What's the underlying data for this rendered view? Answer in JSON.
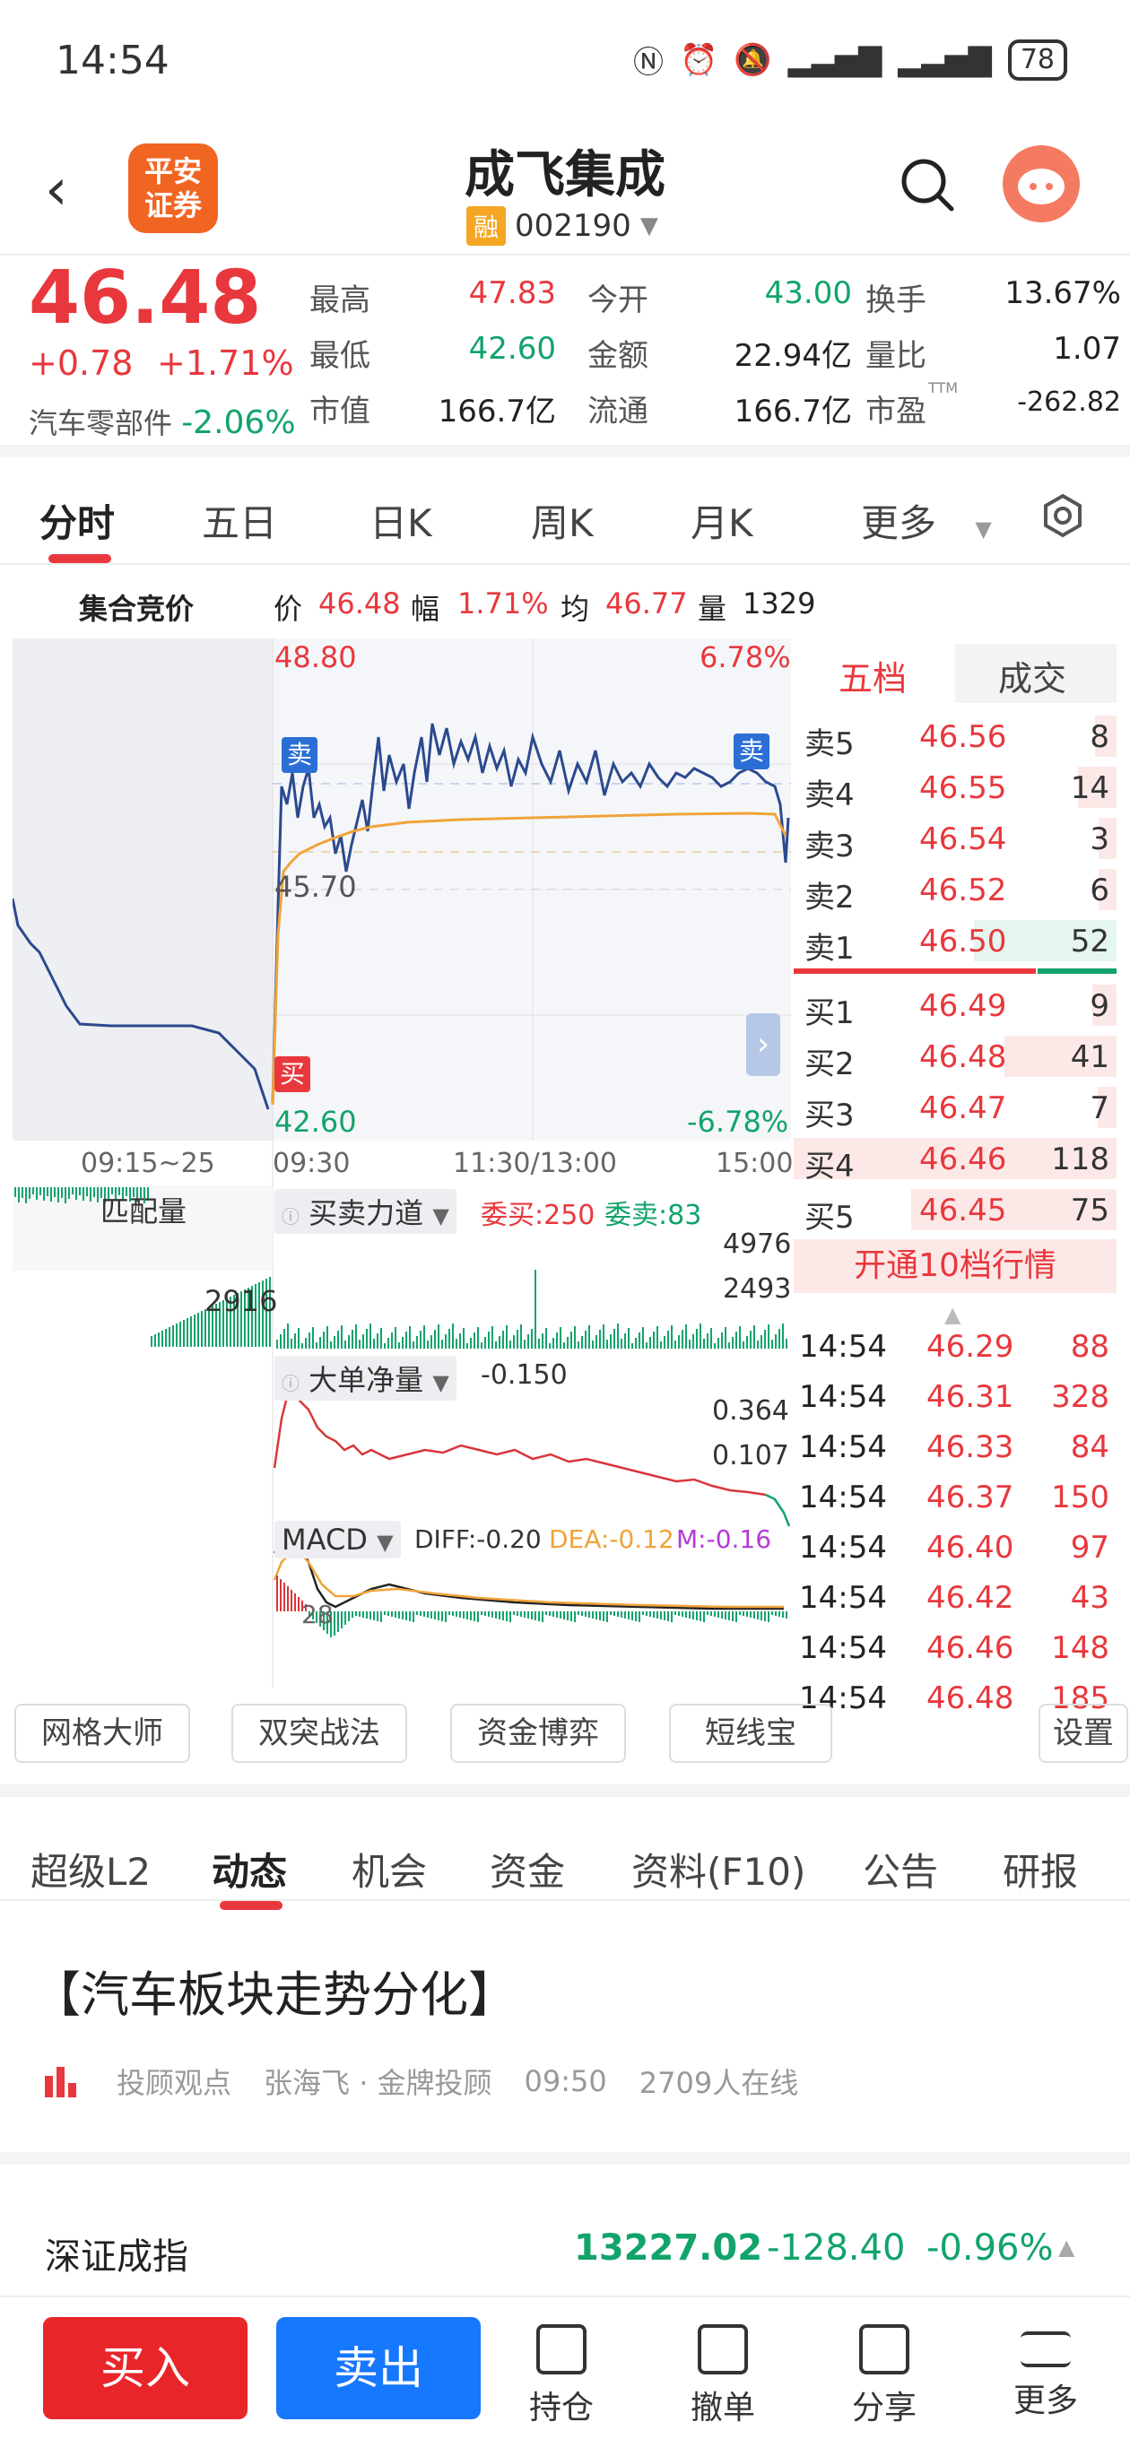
{
  "status": {
    "time": "14:54",
    "battery": "78"
  },
  "header": {
    "title": "成飞集成",
    "code": "002190",
    "margin_tag": "融",
    "broker_logo_line1": "平安",
    "broker_logo_line2": "证券"
  },
  "quote": {
    "price": "46.48",
    "change": "+0.78",
    "change_pct": "+1.71%",
    "sector_name": "汽车零部件",
    "sector_change": "-2.06%",
    "fields": [
      {
        "label": "最高",
        "value": "47.83",
        "color": "red"
      },
      {
        "label": "今开",
        "value": "43.00",
        "color": "green"
      },
      {
        "label": "换手",
        "value": "13.67%",
        "color": "black"
      },
      {
        "label": "最低",
        "value": "42.60",
        "color": "green"
      },
      {
        "label": "金额",
        "value": "22.94亿",
        "color": "black"
      },
      {
        "label": "量比",
        "value": "1.07",
        "color": "black"
      },
      {
        "label": "市值",
        "value": "166.7亿",
        "color": "black"
      },
      {
        "label": "流通",
        "value": "166.7亿",
        "color": "black"
      },
      {
        "label": "市盈",
        "value": "-262.82",
        "color": "black",
        "sup": "TTM"
      }
    ]
  },
  "chart_tabs": [
    "分时",
    "五日",
    "日K",
    "周K",
    "月K",
    "更多"
  ],
  "info_line": {
    "label": "集合竞价",
    "price_label": "价",
    "price": "46.48",
    "amp_label": "幅",
    "amp": "1.71%",
    "avg_label": "均",
    "avg": "46.77",
    "vol_label": "量",
    "vol": "1329"
  },
  "chart": {
    "y_top": "48.80",
    "y_mid": "45.70",
    "y_bottom": "42.60",
    "pct_top": "6.78%",
    "pct_bottom": "-6.78%",
    "x_labels": [
      "09:15~25",
      "09:30",
      "11:30/13:00",
      "15:00"
    ],
    "sell_marker": "卖",
    "buy_marker": "买",
    "match_label": "匹配量",
    "match_value": "2916",
    "force_label": "买卖力道",
    "force_buy": "委买:250",
    "force_sell": "委卖:83",
    "force_max": "4976",
    "force_mid": "2493",
    "bignet_label": "大单净量",
    "bignet_value": "-0.150",
    "bignet_top": "0.364",
    "bignet_mid": "0.107",
    "macd_label": "MACD",
    "diff": "DIFF:-0.20",
    "dea": "DEA:-0.12",
    "m": "M:-0.16",
    "macd_tick": "28"
  },
  "orderbook": {
    "tabs": [
      "五档",
      "成交"
    ],
    "asks": [
      {
        "label": "卖5",
        "price": "46.56",
        "vol": "8"
      },
      {
        "label": "卖4",
        "price": "46.55",
        "vol": "14"
      },
      {
        "label": "卖3",
        "price": "46.54",
        "vol": "3"
      },
      {
        "label": "卖2",
        "price": "46.52",
        "vol": "6"
      },
      {
        "label": "卖1",
        "price": "46.50",
        "vol": "52"
      }
    ],
    "bids": [
      {
        "label": "买1",
        "price": "46.49",
        "vol": "9"
      },
      {
        "label": "买2",
        "price": "46.48",
        "vol": "41"
      },
      {
        "label": "买3",
        "price": "46.47",
        "vol": "7"
      },
      {
        "label": "买4",
        "price": "46.46",
        "vol": "118"
      },
      {
        "label": "买5",
        "price": "46.45",
        "vol": "75"
      }
    ],
    "upgrade": "开通10档行情",
    "trades": [
      {
        "time": "14:54",
        "price": "46.29",
        "vol": "88"
      },
      {
        "time": "14:54",
        "price": "46.31",
        "vol": "328"
      },
      {
        "time": "14:54",
        "price": "46.33",
        "vol": "84"
      },
      {
        "time": "14:54",
        "price": "46.37",
        "vol": "150"
      },
      {
        "time": "14:54",
        "price": "46.40",
        "vol": "97"
      },
      {
        "time": "14:54",
        "price": "46.42",
        "vol": "43"
      },
      {
        "time": "14:54",
        "price": "46.46",
        "vol": "148"
      },
      {
        "time": "14:54",
        "price": "46.48",
        "vol": "185"
      }
    ]
  },
  "tools": [
    "网格大师",
    "双突战法",
    "资金博弈",
    "短线宝",
    "设置"
  ],
  "news_tabs": [
    "超级L2",
    "动态",
    "机会",
    "资金",
    "资料(F10)",
    "公告",
    "研报"
  ],
  "news": {
    "headline": "【汽车板块走势分化】",
    "source": "投顾观点",
    "author": "张海飞 · 金牌投顾",
    "time": "09:50",
    "online": "2709人在线"
  },
  "index": {
    "name": "深证成指",
    "value": "13227.02",
    "change": "-128.40",
    "pct": "-0.96%"
  },
  "bottom": {
    "buy": "买入",
    "sell": "卖出",
    "nav": [
      "持仓",
      "撤单",
      "分享",
      "更多"
    ]
  }
}
